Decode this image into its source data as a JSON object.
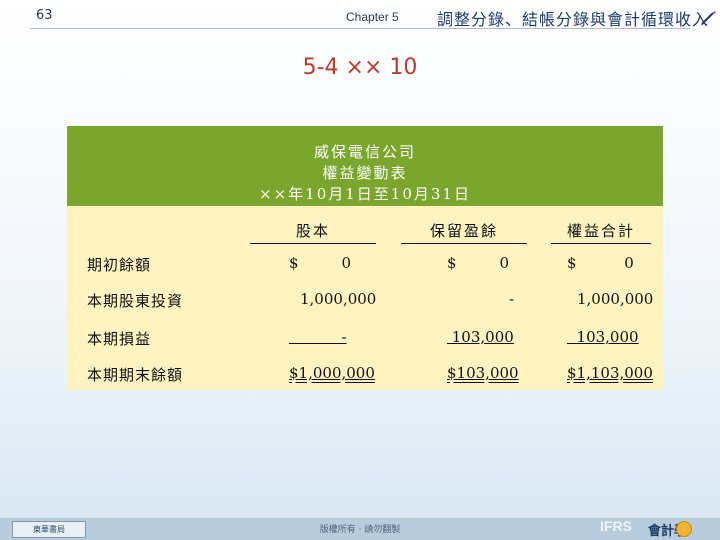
{
  "header": {
    "page_number": "63",
    "chapter": "Chapter 5",
    "chapter_title": "調整分錄、結帳分錄與會計循環收入"
  },
  "slide_title": "5-4 ×× 10",
  "statement": {
    "company": "威保電信公司",
    "name": "權益變動表",
    "period": "××年10月1日至10月31日",
    "columns": [
      "股本",
      "保留盈餘",
      "權益合計"
    ],
    "rows": [
      {
        "label": "期初餘額",
        "cells": [
          "$         0",
          "$         0",
          "$          0"
        ]
      },
      {
        "label": "本期股東投資",
        "cells": [
          "1,000,000",
          "-",
          "1,000,000"
        ]
      },
      {
        "label": "本期損益",
        "cells": [
          "           -",
          " 103,000",
          "  103,000"
        ]
      },
      {
        "label": "本期期末餘額",
        "cells": [
          "$1,000,000",
          "$103,000",
          "$1,103,000"
        ]
      }
    ]
  },
  "footer": {
    "logo_text": "東華書局",
    "copyright": "版權所有 · 請勿翻製",
    "brand_latin": "IFRS",
    "brand_cn": "會計學"
  },
  "colors": {
    "header_green": "#7aa62d",
    "table_bg": "#fdf3c1",
    "title_red": "#c0392b"
  }
}
